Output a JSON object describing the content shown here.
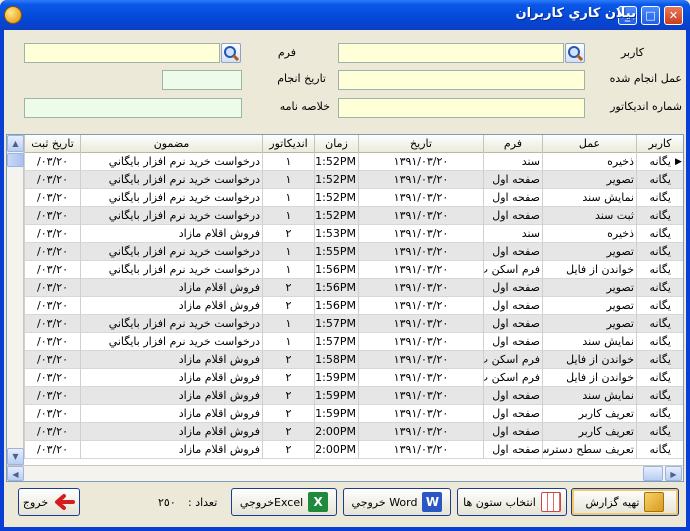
{
  "window": {
    "title": "بيلان کاري کاربران"
  },
  "filters": {
    "user_label": "کاربر",
    "form_label": "فرم",
    "action_label": "عمل انجام شده",
    "date_label": "تاريخ انجام",
    "indicator_label": "شماره انديکاتور",
    "summary_label": "خلاصه نامه",
    "user_value": "",
    "form_value": "",
    "action_value": "",
    "date_value": "",
    "indicator_value": "",
    "summary_value": ""
  },
  "grid": {
    "columns": [
      "کاربر",
      "عمل",
      "فرم",
      "تاريخ",
      "زمان",
      "انديکاتور",
      "مضمون",
      "تاريخ ثبت"
    ],
    "rows": [
      [
        "يگانه",
        "ذخيره",
        "سند",
        "١٣٩١/٠٣/٢٠",
        "1:52PM",
        "١",
        "درخواست خريد نرم افزار بايگاني",
        "٠٣/٢٠/"
      ],
      [
        "يگانه",
        "تصوير",
        "صفحه اول",
        "١٣٩١/٠٣/٢٠",
        "1:52PM",
        "١",
        "درخواست خريد نرم افزار بايگاني",
        "٠٣/٢٠/"
      ],
      [
        "يگانه",
        "نمايش سند",
        "صفحه اول",
        "١٣٩١/٠٣/٢٠",
        "1:52PM",
        "١",
        "درخواست خريد نرم افزار بايگاني",
        "٠٣/٢٠/"
      ],
      [
        "يگانه",
        "ثبت سند",
        "صفحه اول",
        "١٣٩١/٠٣/٢٠",
        "1:52PM",
        "١",
        "درخواست خريد نرم افزار بايگاني",
        "٠٣/٢٠/"
      ],
      [
        "يگانه",
        "ذخيره",
        "سند",
        "١٣٩١/٠٣/٢٠",
        "1:53PM",
        "٢",
        "فروش اقلام مازاد",
        "٠٣/٢٠/"
      ],
      [
        "يگانه",
        "تصوير",
        "صفحه اول",
        "١٣٩١/٠٣/٢٠",
        "1:55PM",
        "١",
        "درخواست خريد نرم افزار بايگاني",
        "٠٣/٢٠/"
      ],
      [
        "يگانه",
        "خواندن از فايل",
        "فرم اسکن پ",
        "١٣٩١/٠٣/٢٠",
        "1:56PM",
        "١",
        "درخواست خريد نرم افزار بايگاني",
        "٠٣/٢٠/"
      ],
      [
        "يگانه",
        "تصوير",
        "صفحه اول",
        "١٣٩١/٠٣/٢٠",
        "1:56PM",
        "٢",
        "فروش اقلام مازاد",
        "٠٣/٢٠/"
      ],
      [
        "يگانه",
        "تصوير",
        "صفحه اول",
        "١٣٩١/٠٣/٢٠",
        "1:56PM",
        "٢",
        "فروش اقلام مازاد",
        "٠٣/٢٠/"
      ],
      [
        "يگانه",
        "تصوير",
        "صفحه اول",
        "١٣٩١/٠٣/٢٠",
        "1:57PM",
        "١",
        "درخواست خريد نرم افزار بايگاني",
        "٠٣/٢٠/"
      ],
      [
        "يگانه",
        "نمايش سند",
        "صفحه اول",
        "١٣٩١/٠٣/٢٠",
        "1:57PM",
        "١",
        "درخواست خريد نرم افزار بايگاني",
        "٠٣/٢٠/"
      ],
      [
        "يگانه",
        "خواندن از فايل",
        "فرم اسکن پ",
        "١٣٩١/٠٣/٢٠",
        "1:58PM",
        "٢",
        "فروش اقلام مازاد",
        "٠٣/٢٠/"
      ],
      [
        "يگانه",
        "خواندن از فايل",
        "فرم اسکن پ",
        "١٣٩١/٠٣/٢٠",
        "1:59PM",
        "٢",
        "فروش اقلام مازاد",
        "٠٣/٢٠/"
      ],
      [
        "يگانه",
        "نمايش سند",
        "صفحه اول",
        "١٣٩١/٠٣/٢٠",
        "1:59PM",
        "٢",
        "فروش اقلام مازاد",
        "٠٣/٢٠/"
      ],
      [
        "يگانه",
        "تعريف کاربر",
        "صفحه اول",
        "١٣٩١/٠٣/٢٠",
        "1:59PM",
        "٢",
        "فروش اقلام مازاد",
        "٠٣/٢٠/"
      ],
      [
        "يگانه",
        "تعريف کاربر",
        "صفحه اول",
        "١٣٩١/٠٣/٢٠",
        "2:00PM",
        "٢",
        "فروش اقلام مازاد",
        "٠٣/٢٠/"
      ],
      [
        "يگانه",
        "تعريف سطح دسترس",
        "صفحه اول",
        "١٣٩١/٠٣/٢٠",
        "2:00PM",
        "٢",
        "فروش اقلام مازاد",
        "٠٣/٢٠/"
      ]
    ]
  },
  "footer": {
    "report_button": "تهيه گزارش",
    "columns_button": "انتخاب ستون ها",
    "word_button": "Word خروجي",
    "excel_button": "Excelخروجي",
    "count_label": "تعداد :",
    "count_value": "٢٥٠",
    "exit_button": "خروج"
  }
}
